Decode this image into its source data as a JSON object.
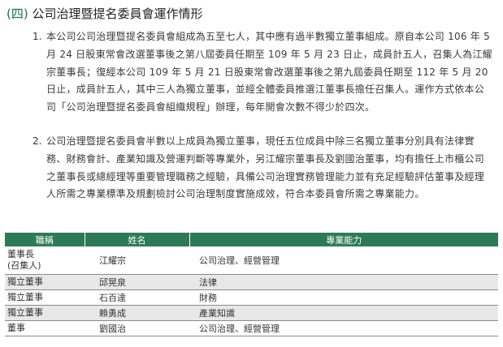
{
  "section": {
    "title_open": "(四)",
    "title_text": "公司治理暨提名委員會運作情形"
  },
  "paragraphs": [
    {
      "number": "1.",
      "text": "本公司公司治理暨提名委員會組成為五至七人，其中應有過半數獨立董事組成。原自本公司 106 年 5 月 24 日股東常會改選董事後之第八屆委員任期至 109 年 5 月 23 日止，成員計五人，召集人為江耀宗董事長；復經本公司 109 年 5 月 21 日股東常會改選董事後之第九屆委員任期至 112 年 5 月 20 日止，成員計五人，其中三人為獨立董事，並經全體委員推選江董事長擔任召集人。運作方式依本公司「公司治理暨提名委員會組織規程」辦理，每年開會次數不得少於四次。"
    },
    {
      "number": "2.",
      "text": "公司治理暨提名委員會半數以上成員為獨立董事，現任五位成員中除三名獨立董事分別具有法律實務、財務會計、產業知識及營運判斷等專業外，另江耀宗董事長及劉國治董事，均有擔任上市櫃公司之董事長或總經理等重要管理職務之經驗，具備公司治理實務管理能力並有充足經驗評估董事及經理人所需之專業標準及規劃檢討公司治理制度實施成效，符合本委員會所需之專業能力。"
    }
  ],
  "table": {
    "headers": [
      "職稱",
      "姓名",
      "專業能力"
    ],
    "rows": [
      {
        "title": "董事長",
        "title_note": "(召集人)",
        "name": "江耀宗",
        "skill": "公司治理、經營管理"
      },
      {
        "title": "獨立董事",
        "name": "邱晃泉",
        "skill": "法律"
      },
      {
        "title": "獨立董事",
        "name": "石百達",
        "skill": "財務"
      },
      {
        "title": "獨立董事",
        "name": "賴勇成",
        "skill": "產業知識"
      },
      {
        "title": "董事",
        "name": "劉國治",
        "skill": "公司治理、經營管理"
      }
    ]
  },
  "colors": {
    "header_green": "#2e7a58",
    "accent_paren": "#1f6f48",
    "row_shade": "#e8e8e8"
  }
}
